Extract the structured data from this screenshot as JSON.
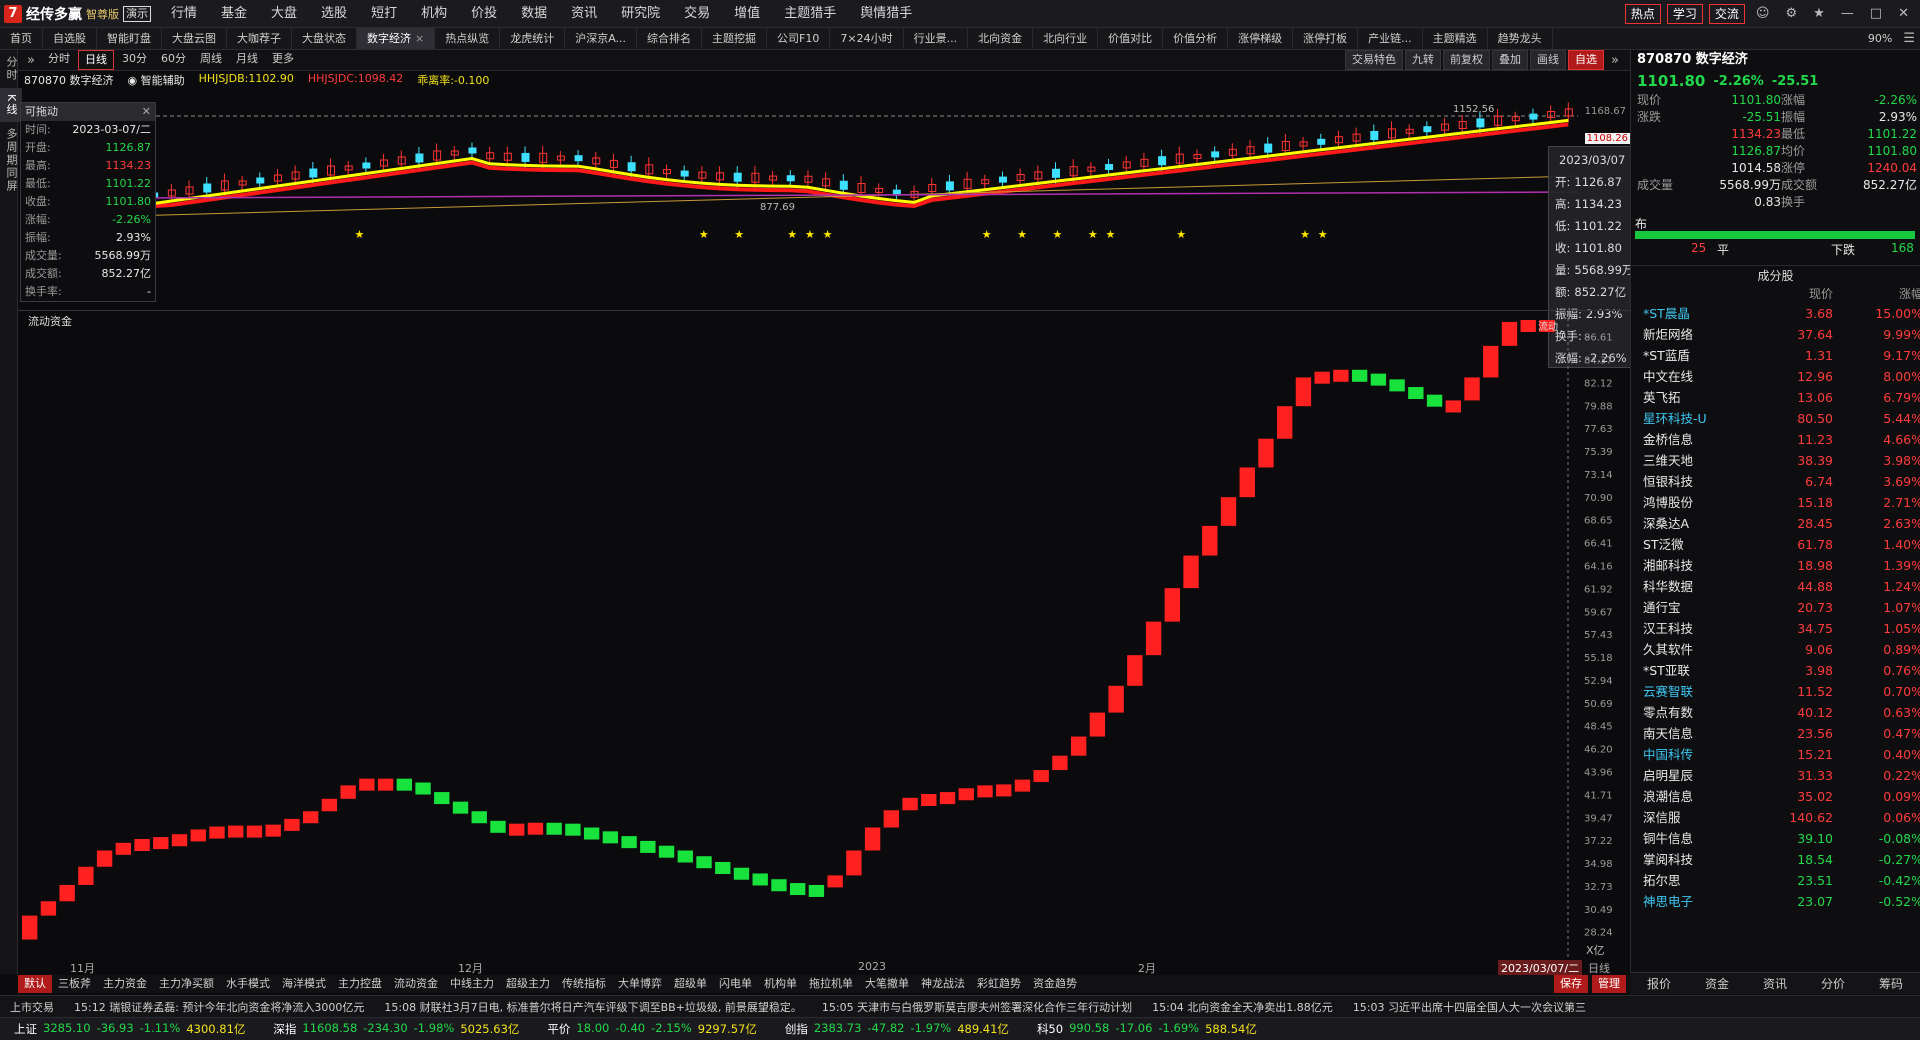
{
  "app": {
    "logo_mark": "7",
    "name": "经传多赢",
    "edition": "智尊版",
    "demo": "演示"
  },
  "menu": [
    {
      "label": "行情",
      "dot": false
    },
    {
      "label": "基金",
      "dot": false
    },
    {
      "label": "大盘",
      "dot": true
    },
    {
      "label": "选股",
      "dot": true
    },
    {
      "label": "短打",
      "dot": true
    },
    {
      "label": "机构",
      "dot": false
    },
    {
      "label": "价投",
      "dot": true
    },
    {
      "label": "数据",
      "dot": false
    },
    {
      "label": "资讯",
      "dot": false
    },
    {
      "label": "研究院",
      "dot": false
    },
    {
      "label": "交易",
      "dot": false
    },
    {
      "label": "增值",
      "dot": true
    },
    {
      "label": "主题猎手",
      "dot": true
    },
    {
      "label": "舆情猎手",
      "dot": true
    }
  ],
  "menu_right": {
    "hot": "热点",
    "learn": "学习",
    "exchange": "交流"
  },
  "tabs": [
    "首页",
    "自选股",
    "智能盯盘",
    "大盘云图",
    "大咖荐子",
    "大盘状态",
    "数字经济",
    "热点纵览",
    "龙虎统计",
    "沪深京A...",
    "综合排名",
    "主题挖掘",
    "公司F10",
    "7×24小时",
    "行业景...",
    "北向资金",
    "北向行业",
    "价值对比",
    "价值分析",
    "涨停梯级",
    "涨停打板",
    "产业链...",
    "主题精选",
    "趋势龙头"
  ],
  "active_tab": "数字经济",
  "zoom": "90%",
  "left_tabs": [
    "分时",
    "K线",
    "多周期同屏"
  ],
  "periods": [
    "分时",
    "日线",
    "30分",
    "60分",
    "周线",
    "月线",
    "更多"
  ],
  "active_period": "日线",
  "toolbar_right": [
    "交易特色",
    "九转",
    "前复权",
    "叠加",
    "画线",
    "自选"
  ],
  "chart_head": {
    "code_name": "870870 数字经济",
    "assist": "智能辅助",
    "hhjsjdb": "HHJSJDB:1102.90",
    "hhjsjdc": "HHJSJDC:1098.42",
    "rate": "乖离率:-0.100"
  },
  "floatbox": {
    "title": "可拖动",
    "rows": [
      {
        "k": "时间:",
        "v": "2023-03-07/二",
        "c": "wh"
      },
      {
        "k": "开盘:",
        "v": "1126.87",
        "c": "dn"
      },
      {
        "k": "最高:",
        "v": "1134.23",
        "c": "up"
      },
      {
        "k": "最低:",
        "v": "1101.22",
        "c": "dn"
      },
      {
        "k": "收盘:",
        "v": "1101.80",
        "c": "dn"
      },
      {
        "k": "涨幅:",
        "v": "-2.26%",
        "c": "dn"
      },
      {
        "k": "振幅:",
        "v": "2.93%",
        "c": "wh"
      },
      {
        "k": "成交量:",
        "v": "5568.99万",
        "c": "wh"
      },
      {
        "k": "成交额:",
        "v": "852.27亿",
        "c": "wh"
      },
      {
        "k": "换手率:",
        "v": "-",
        "c": "wh"
      }
    ]
  },
  "cursor_box": [
    {
      "k": "",
      "v": "2023/03/07"
    },
    {
      "k": "开:",
      "v": "1126.87"
    },
    {
      "k": "高:",
      "v": "1134.23"
    },
    {
      "k": "低:",
      "v": "1101.22"
    },
    {
      "k": "收:",
      "v": "1101.80"
    },
    {
      "k": "量:",
      "v": "5568.99万"
    },
    {
      "k": "额:",
      "v": "852.27亿"
    },
    {
      "k": "振幅:",
      "v": "2.93%"
    },
    {
      "k": "换手:",
      "v": "-"
    },
    {
      "k": "涨幅:",
      "v": "-2.26%"
    }
  ],
  "main_axis": {
    "high": "1168.67",
    "current": "1108.26"
  },
  "main_annotations": {
    "peak": "1152.56",
    "low": "877.69"
  },
  "indicator_label": "流动资金",
  "indicator_corner": "流动",
  "lower_axis": [
    "86.61",
    "84.37",
    "82.12",
    "79.88",
    "77.63",
    "75.39",
    "73.14",
    "70.90",
    "68.65",
    "66.41",
    "64.16",
    "61.92",
    "59.67",
    "57.43",
    "55.18",
    "52.94",
    "50.69",
    "48.45",
    "46.20",
    "43.96",
    "41.71",
    "39.47",
    "37.22",
    "34.98",
    "32.73",
    "30.49",
    "28.24"
  ],
  "lower_unit": "X亿",
  "date_labels": [
    "11月",
    "12月",
    "2023",
    "2月"
  ],
  "date_cursor": "2023/03/07/二",
  "date_period": "日线",
  "indicator_tabs": [
    "默认",
    "三板斧",
    "主力资金",
    "主力净买额",
    "水手模式",
    "海洋模式",
    "主力控盘",
    "流动资金",
    "中线主力",
    "超级主力",
    "传统指标",
    "大单博弈",
    "超级单",
    "闪电单",
    "机构单",
    "拖拉机单",
    "大笔撤单",
    "神龙战法",
    "彩虹趋势",
    "资金趋势"
  ],
  "active_indicator": "默认",
  "indicator_right": [
    "保存",
    "管理"
  ],
  "ticker": [
    "上市交易",
    "15:12 瑞银证券孟磊: 预计今年北向资金将净流入3000亿元",
    "15:08 财联社3月7日电, 标准普尔将日产汽车评级下调至BB+垃圾级, 前景展望稳定。",
    "15:05 天津市与白俄罗斯莫吉廖夫州签署深化合作三年行动计划",
    "15:04 北向资金全天净卖出1.88亿元",
    "15:03 习近平出席十四届全国人大一次会议第三"
  ],
  "indices": [
    {
      "name": "上证",
      "v": "3285.10",
      "d": "-36.93",
      "p": "-1.11%",
      "amt": "4300.81亿"
    },
    {
      "name": "深指",
      "v": "11608.58",
      "d": "-234.30",
      "p": "-1.98%",
      "amt": "5025.63亿"
    },
    {
      "name": "平价",
      "v": "18.00",
      "d": "-0.40",
      "p": "-2.15%",
      "amt": "9297.57亿"
    },
    {
      "name": "创指",
      "v": "2383.73",
      "d": "-47.82",
      "p": "-1.97%",
      "amt": "489.41亿"
    },
    {
      "name": "科50",
      "v": "990.58",
      "d": "-17.06",
      "p": "-1.69%",
      "amt": "588.54亿"
    }
  ],
  "quote": {
    "title": "870870 数字经济",
    "price": "1101.80",
    "pct": "-2.26%",
    "chg": "-25.51",
    "rows": [
      [
        "现价",
        "1101.80",
        "涨幅",
        "-2.26%"
      ],
      [
        "涨跌",
        "-25.51",
        "振幅",
        "2.93%"
      ],
      [
        "",
        "1134.23",
        "最低",
        "1101.22"
      ],
      [
        "",
        "1126.87",
        "均价",
        "1101.80"
      ],
      [
        "",
        "1014.58",
        "涨停",
        "1240.04"
      ],
      [
        "成交量",
        "5568.99万",
        "成交额",
        "852.27亿"
      ],
      [
        "",
        "0.83",
        "换手",
        ""
      ]
    ],
    "breadth_label": "布",
    "breadth_flat": "25",
    "breadth_flat_label": "平",
    "breadth_down_label": "下跌",
    "breadth_down": "168",
    "sector_head": "成分股",
    "sector_cols": [
      "",
      "现价",
      "涨幅"
    ]
  },
  "sectors": [
    {
      "name": "*ST晨晶",
      "p": "3.68",
      "c": "15.00%",
      "cy": true
    },
    {
      "name": "新炬网络",
      "p": "37.64",
      "c": "9.99%",
      "cy": false
    },
    {
      "name": "*ST蓝盾",
      "p": "1.31",
      "c": "9.17%",
      "cy": false
    },
    {
      "name": "中文在线",
      "p": "12.96",
      "c": "8.00%",
      "cy": false
    },
    {
      "name": "英飞拓",
      "p": "13.06",
      "c": "6.79%",
      "cy": false
    },
    {
      "name": "星环科技-U",
      "p": "80.50",
      "c": "5.44%",
      "cy": true
    },
    {
      "name": "金桥信息",
      "p": "11.23",
      "c": "4.66%",
      "cy": false
    },
    {
      "name": "三维天地",
      "p": "38.39",
      "c": "3.98%",
      "cy": false
    },
    {
      "name": "恒银科技",
      "p": "6.74",
      "c": "3.69%",
      "cy": false
    },
    {
      "name": "鸿博股份",
      "p": "15.18",
      "c": "2.71%",
      "cy": false
    },
    {
      "name": "深桑达A",
      "p": "28.45",
      "c": "2.63%",
      "cy": false
    },
    {
      "name": "ST泛微",
      "p": "61.78",
      "c": "1.40%",
      "cy": false
    },
    {
      "name": "湘邮科技",
      "p": "18.98",
      "c": "1.39%",
      "cy": false
    },
    {
      "name": "科华数据",
      "p": "44.88",
      "c": "1.24%",
      "cy": false
    },
    {
      "name": "通行宝",
      "p": "20.73",
      "c": "1.07%",
      "cy": false
    },
    {
      "name": "汉王科技",
      "p": "34.75",
      "c": "1.05%",
      "cy": false
    },
    {
      "name": "久其软件",
      "p": "9.06",
      "c": "0.89%",
      "cy": false
    },
    {
      "name": "*ST亚联",
      "p": "3.98",
      "c": "0.76%",
      "cy": false
    },
    {
      "name": "云赛智联",
      "p": "11.52",
      "c": "0.70%",
      "cy": true
    },
    {
      "name": "零点有数",
      "p": "40.12",
      "c": "0.63%",
      "cy": false
    },
    {
      "name": "南天信息",
      "p": "23.56",
      "c": "0.47%",
      "cy": false
    },
    {
      "name": "中国科传",
      "p": "15.21",
      "c": "0.40%",
      "cy": true
    },
    {
      "name": "启明星辰",
      "p": "31.33",
      "c": "0.22%",
      "cy": false
    },
    {
      "name": "浪潮信息",
      "p": "35.02",
      "c": "0.09%",
      "cy": false
    },
    {
      "name": "深信服",
      "p": "140.62",
      "c": "0.06%",
      "cy": false
    },
    {
      "name": "铜牛信息",
      "p": "39.10",
      "c": "-0.08%",
      "cy": false
    },
    {
      "name": "掌阅科技",
      "p": "18.54",
      "c": "-0.27%",
      "cy": false
    },
    {
      "name": "拓尔思",
      "p": "23.51",
      "c": "-0.42%",
      "cy": false
    },
    {
      "name": "神思电子",
      "p": "23.07",
      "c": "-0.52%",
      "cy": true
    }
  ],
  "right_tabs": [
    "报价",
    "资金",
    "资讯",
    "分价",
    "筹码"
  ],
  "colors": {
    "up": "#ff2020",
    "down": "#18e23c",
    "ma_yellow": "#ffff00",
    "ma_red": "#ff1a1a",
    "ma_orange": "#c89a3a",
    "ma_purple": "#b030b0",
    "star": "#ffe600",
    "candle_up": "#ff3333",
    "candle_down": "#3ee0ff"
  },
  "chart_data": {
    "type": "bar",
    "title": "流动资金",
    "ylabel": "",
    "ylim": [
      26,
      92
    ],
    "values": [
      29.8,
      31.3,
      33.0,
      34.9,
      36.6,
      37.4,
      37.8,
      38.0,
      38.3,
      38.8,
      39.1,
      39.2,
      39.2,
      39.3,
      39.9,
      40.7,
      42.0,
      43.4,
      44.1,
      44.1,
      43.7,
      42.7,
      41.7,
      40.7,
      39.7,
      39.3,
      39.4,
      39.5,
      39.4,
      39.0,
      38.6,
      38.1,
      37.6,
      37.1,
      36.6,
      36.0,
      35.4,
      34.8,
      34.2,
      33.6,
      33.2,
      33.0,
      33.0,
      34.0,
      36.6,
      39.0,
      40.8,
      42.1,
      42.5,
      42.7,
      43.1,
      43.4,
      43.5,
      44.0,
      45.0,
      46.5,
      48.5,
      51.0,
      53.8,
      57.0,
      60.5,
      64.0,
      67.4,
      70.5,
      73.5,
      76.6,
      79.6,
      83.0,
      86.0,
      86.6,
      86.8,
      86.4,
      85.8,
      85.0,
      84.2,
      83.6,
      83.6,
      86.0,
      89.3,
      91.8,
      92.0,
      92.0
    ],
    "colors": [
      1,
      1,
      1,
      1,
      1,
      1,
      1,
      1,
      1,
      1,
      1,
      1,
      1,
      1,
      1,
      1,
      1,
      1,
      1,
      1,
      0,
      0,
      0,
      0,
      0,
      0,
      1,
      1,
      0,
      0,
      0,
      0,
      0,
      0,
      0,
      0,
      0,
      0,
      0,
      0,
      0,
      0,
      0,
      1,
      1,
      1,
      1,
      1,
      1,
      1,
      1,
      1,
      1,
      1,
      1,
      1,
      1,
      1,
      1,
      1,
      1,
      1,
      1,
      1,
      1,
      1,
      1,
      1,
      1,
      1,
      1,
      0,
      0,
      0,
      0,
      0,
      1,
      1,
      1,
      1,
      1,
      1
    ]
  }
}
